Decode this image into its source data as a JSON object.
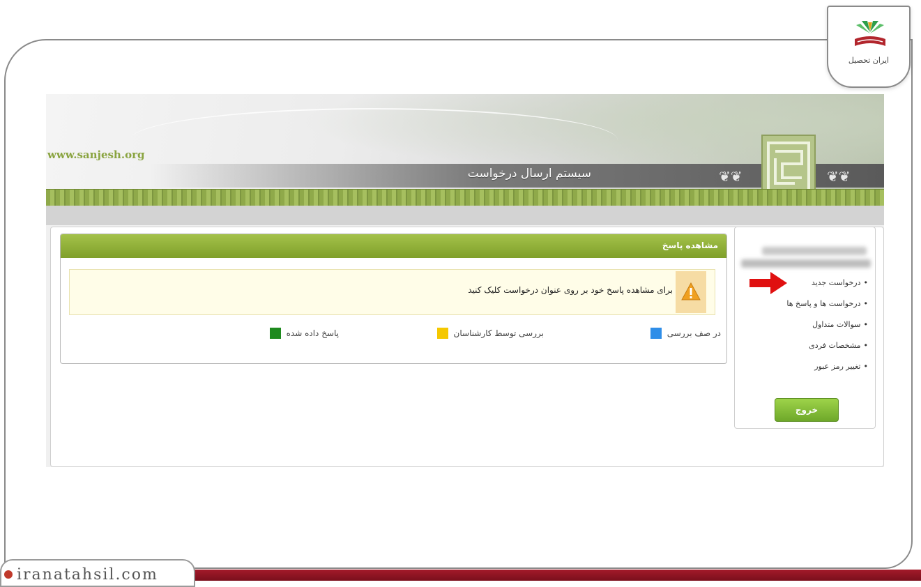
{
  "watermark": {
    "text": "iranatahsil.com"
  },
  "brand": {
    "name": "ایران تحصیل"
  },
  "banner": {
    "url": "www.sanjesh.org",
    "title": "سیستم ارسال درخواست"
  },
  "panel": {
    "title": "مشاهده پاسخ",
    "notice": "برای مشاهده پاسخ خود بر روی عنوان درخواست کلیک کنید",
    "legend": [
      {
        "label": "در صف بررسی",
        "color": "#2f8ee8"
      },
      {
        "label": "بررسی توسط کارشناسان",
        "color": "#f5c800"
      },
      {
        "label": "پاسخ داده شده",
        "color": "#1e8a1e"
      }
    ]
  },
  "sidebar": {
    "menu": [
      {
        "label": "درخواست جدید"
      },
      {
        "label": "درخواست ها و پاسخ ها"
      },
      {
        "label": "سوالات متداول"
      },
      {
        "label": "مشخصات فردی"
      },
      {
        "label": "تغییر رمز عبور"
      }
    ],
    "logout_label": "خروج"
  },
  "colors": {
    "accent_green": "#8db43a",
    "bottom_bar": "#8e1524",
    "arrow_red": "#e01010"
  }
}
